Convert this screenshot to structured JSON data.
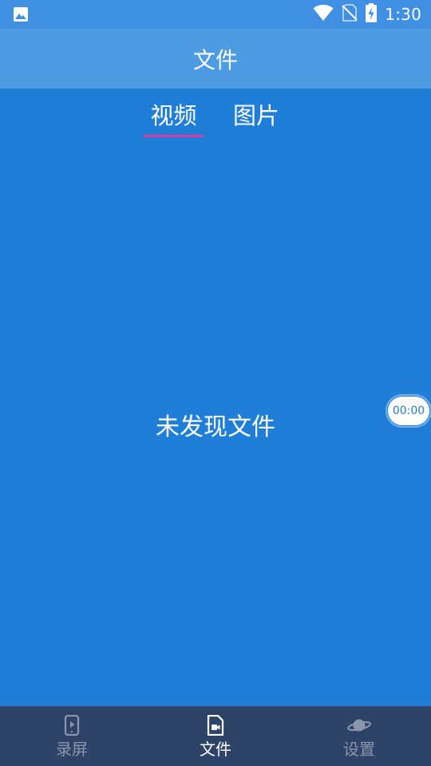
{
  "status_bar": {
    "time": "1:30",
    "icons": [
      "image-icon",
      "wifi-icon",
      "no-sim-icon",
      "battery-charging-icon"
    ]
  },
  "header": {
    "title": "文件"
  },
  "tabs": [
    {
      "label": "视频",
      "selected": true
    },
    {
      "label": "图片",
      "selected": false
    }
  ],
  "content": {
    "empty_message": "未发现文件"
  },
  "floating_timer": {
    "time": "00:00"
  },
  "bottom_nav": [
    {
      "label": "录屏",
      "icon": "phone-play-icon",
      "active": false
    },
    {
      "label": "文件",
      "icon": "video-file-icon",
      "active": true
    },
    {
      "label": "设置",
      "icon": "planet-icon",
      "active": false
    }
  ],
  "colors": {
    "background": "#1f7fd8",
    "status_bar": "#3f8fe2",
    "header": "#4d9be2",
    "tab_indicator": "#e0389b",
    "bottom_nav": "#2d4468",
    "nav_inactive": "#8a97ab",
    "nav_active": "#ffffff"
  }
}
